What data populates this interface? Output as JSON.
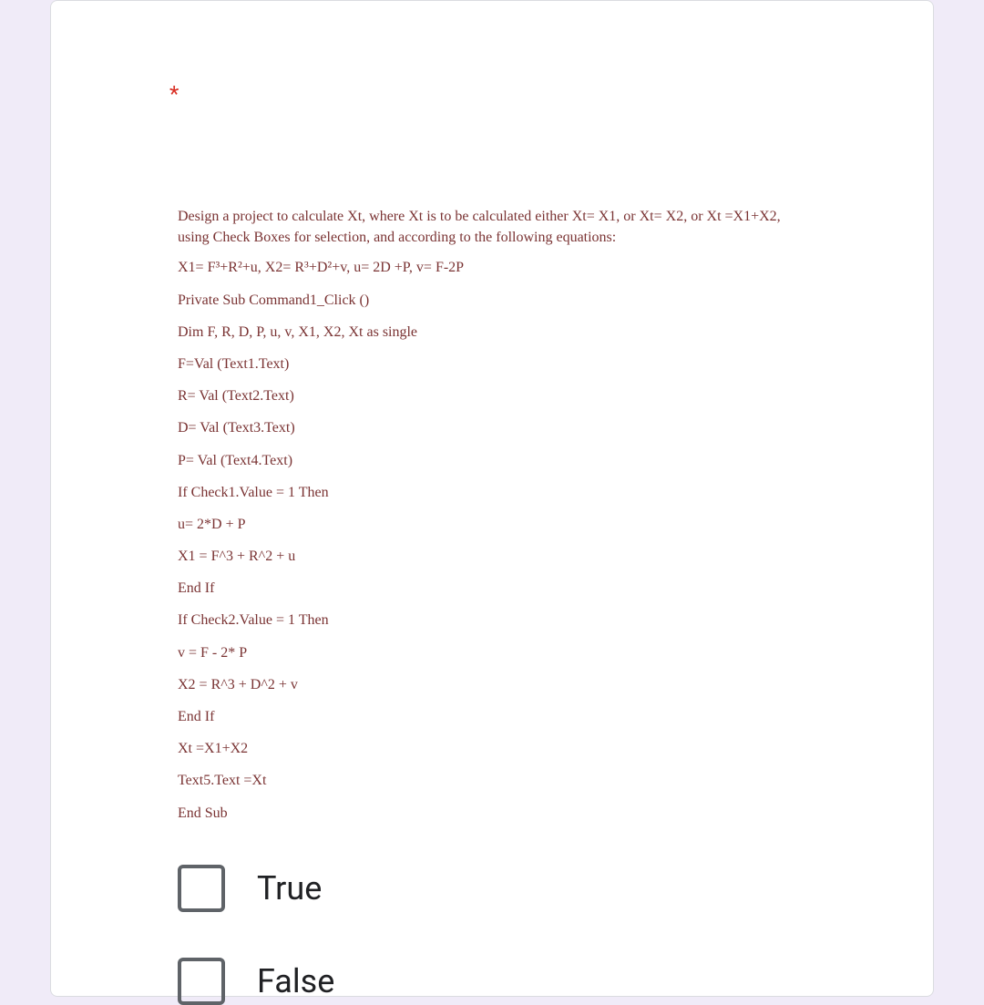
{
  "question": {
    "required_marker": "*",
    "description": {
      "para1": "Design a project to calculate Xt, where Xt is to be calculated either Xt= X1, or Xt= X2, or Xt =X1+X2, using Check Boxes for selection, and according to the following equations:",
      "lines": [
        "X1= F³+R²+u, X2= R³+D²+v, u= 2D +P, v= F-2P",
        "Private Sub Command1_Click ()",
        "Dim F, R, D, P, u, v, X1, X2, Xt as single",
        "F=Val (Text1.Text)",
        "R= Val (Text2.Text)",
        "D= Val (Text3.Text)",
        "P= Val (Text4.Text)",
        "If Check1.Value = 1 Then",
        "u= 2*D + P",
        "X1 = F^3 + R^2 + u",
        "End If",
        "If Check2.Value = 1 Then",
        "v = F - 2* P",
        "X2 = R^3 + D^2 + v",
        "End If",
        "Xt =X1+X2",
        "Text5.Text =Xt",
        "End Sub"
      ]
    },
    "options": [
      {
        "label": "True"
      },
      {
        "label": "False"
      }
    ]
  }
}
